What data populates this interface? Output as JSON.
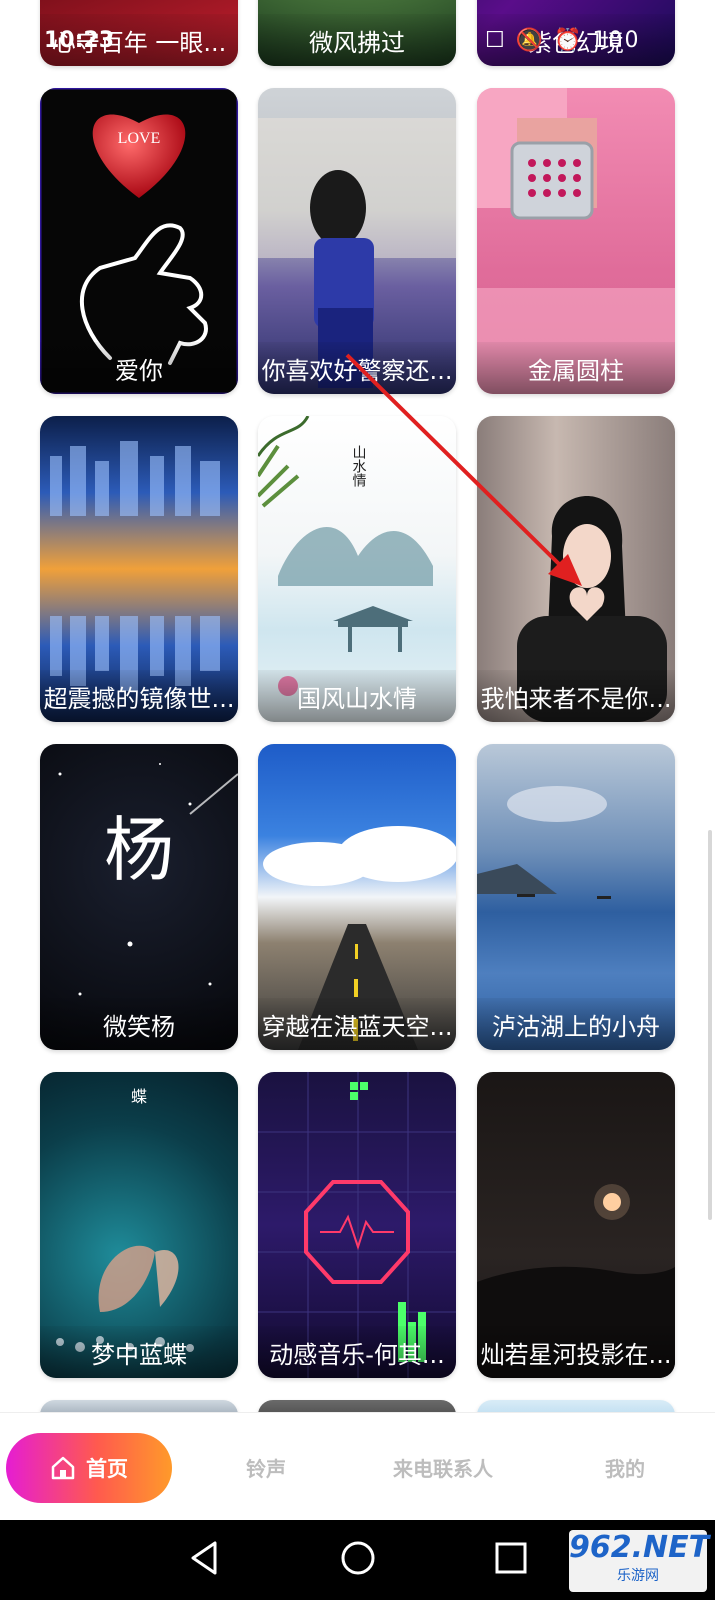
{
  "status_bar": {
    "time": "10:23",
    "icons": "☐ 🔕 ⏰ 100"
  },
  "cards": [
    {
      "label": "心守百年 一眼..."
    },
    {
      "label": "微风拂过"
    },
    {
      "label": "紫色幻境"
    },
    {
      "label": "爱你"
    },
    {
      "label": "你喜欢好警察还..."
    },
    {
      "label": "金属圆柱"
    },
    {
      "label": "超震撼的镜像世..."
    },
    {
      "label": "国风山水情"
    },
    {
      "label": "我怕来者不是你..."
    },
    {
      "label": "微笑杨"
    },
    {
      "label": "穿越在湛蓝天空..."
    },
    {
      "label": "泸沽湖上的小舟"
    },
    {
      "label": "梦中蓝蝶"
    },
    {
      "label": "动感音乐-何其..."
    },
    {
      "label": "灿若星河投影在..."
    }
  ],
  "card_art_text": {
    "love": "LOVE",
    "shanshui": "山水情",
    "yang": "杨",
    "butterfly": "蝶"
  },
  "bottom_nav": {
    "home": "首页",
    "ringtone": "铃声",
    "caller": "来电联系人",
    "mine": "我的"
  },
  "watermark": {
    "brand": "962.NET",
    "sub": "乐游网"
  },
  "colors": {
    "accent_start": "#e51dd3",
    "accent_end": "#ff9a2a",
    "arrow": "#e02020"
  }
}
